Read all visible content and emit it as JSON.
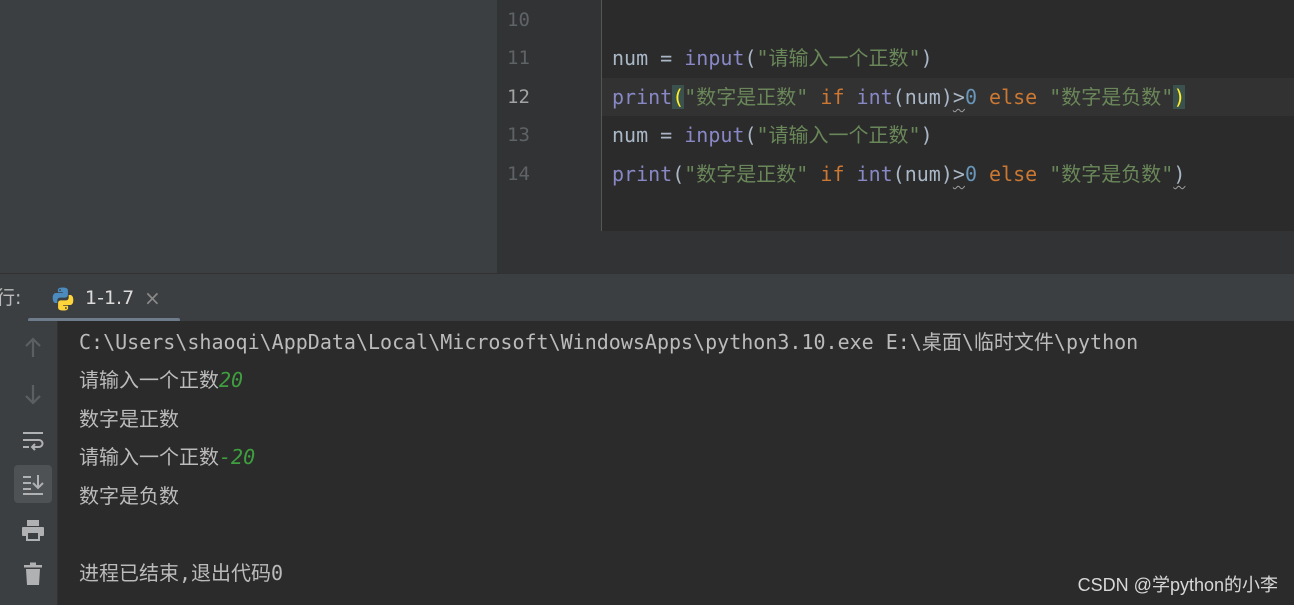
{
  "editor": {
    "lines": [
      {
        "number": "10",
        "code": {}
      },
      {
        "number": "11",
        "code": {
          "var": "num",
          "assign": " = ",
          "func": "input",
          "open": "(",
          "str": "\"请输入一个正数\"",
          "close": ")"
        }
      },
      {
        "number": "12",
        "code": {
          "func": "print",
          "open": "(",
          "str1": "\"数字是正数\"",
          "kw_if": "if",
          "func2": "int",
          "arg": "(num)",
          "gt": ">",
          "num": "0",
          "kw_else": "else",
          "str2": "\"数字是负数\"",
          "close": ")"
        }
      },
      {
        "number": "13",
        "code": {
          "var": "num",
          "assign": " = ",
          "func": "input",
          "open": "(",
          "str": "\"请输入一个正数\"",
          "close": ")"
        }
      },
      {
        "number": "14",
        "code": {
          "func": "print",
          "open": "(",
          "str1": "\"数字是正数\"",
          "kw_if": "if",
          "func2": "int",
          "arg": "(num)",
          "gt": ">",
          "num": "0",
          "kw_else": "else",
          "str2": "\"数字是负数\"",
          "close": ")"
        }
      }
    ]
  },
  "run_panel": {
    "title": "行:",
    "tab": {
      "label": "1-1.7",
      "close": "×",
      "icon": "python-icon"
    },
    "toolbar": [
      "arrow-up-icon",
      "arrow-down-icon",
      "soft-wrap-icon",
      "scroll-to-end-icon",
      "print-icon",
      "trash-icon"
    ]
  },
  "console": {
    "command": "C:\\Users\\shaoqi\\AppData\\Local\\Microsoft\\WindowsApps\\python3.10.exe E:\\桌面\\临时文件\\python",
    "output": [
      {
        "prompt": "请输入一个正数",
        "input": "20"
      },
      {
        "text": "数字是正数"
      },
      {
        "prompt": "请输入一个正数",
        "input": "-20"
      },
      {
        "text": "数字是负数"
      },
      {
        "text": ""
      },
      {
        "text": "进程已结束,退出代码0"
      }
    ]
  },
  "watermark": "CSDN @学python的小李",
  "colors": {
    "editor_bg": "#2b2b2b",
    "panel_bg": "#3c3f41",
    "builtin": "#8888c6",
    "string": "#6a8759",
    "keyword": "#cc7832",
    "number": "#6897bb",
    "user_input": "#3f9f3f"
  }
}
